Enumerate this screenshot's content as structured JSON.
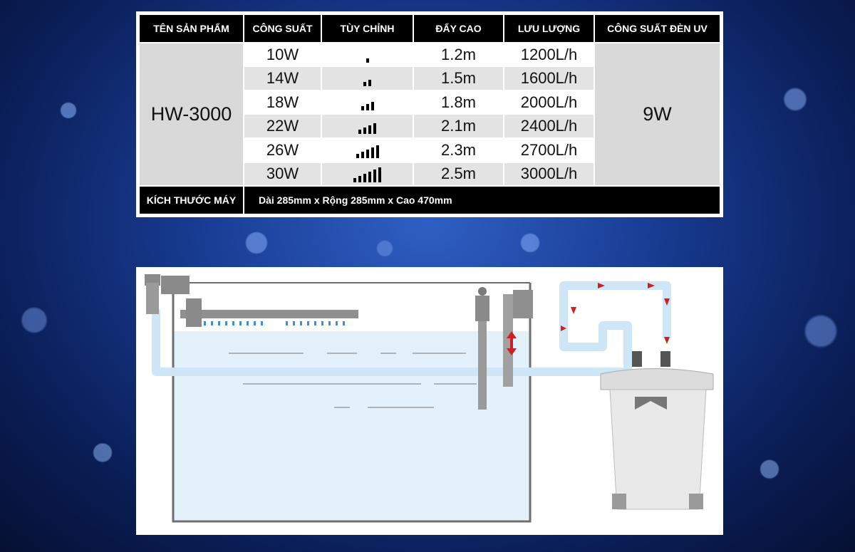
{
  "table": {
    "headers": [
      "TÊN SẢN PHẨM",
      "CÔNG SUẤT",
      "TÙY CHỈNH",
      "ĐẨY CAO",
      "LƯU LƯỢNG",
      "CÔNG SUẤT ĐÈN UV"
    ],
    "model": "HW-3000",
    "uv_power": "9W",
    "rows": [
      {
        "power": "10W",
        "level": 1,
        "head": "1.2m",
        "flow": "1200L/h"
      },
      {
        "power": "14W",
        "level": 2,
        "head": "1.5m",
        "flow": "1600L/h"
      },
      {
        "power": "18W",
        "level": 3,
        "head": "1.8m",
        "flow": "2000L/h"
      },
      {
        "power": "22W",
        "level": 4,
        "head": "2.1m",
        "flow": "2400L/h"
      },
      {
        "power": "26W",
        "level": 5,
        "head": "2.3m",
        "flow": "2700L/h"
      },
      {
        "power": "30W",
        "level": 6,
        "head": "2.5m",
        "flow": "3000L/h"
      }
    ],
    "size_label": "KÍCH THƯỚC MÁY",
    "size_value": "Dài 285mm x Rộng 285mm x Cao 470mm"
  },
  "colors": {
    "header_bg": "#000000",
    "pipe": "#cfe6f7",
    "flow_arrow": "#d11f1f"
  }
}
